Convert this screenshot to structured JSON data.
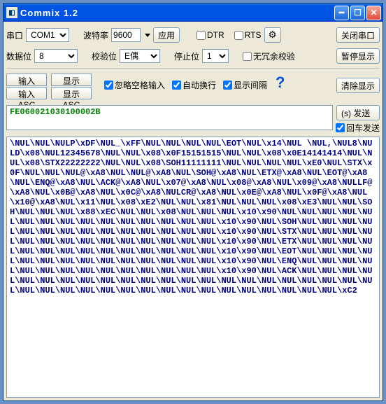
{
  "window": {
    "title": "Commix 1.2"
  },
  "row1": {
    "port_label": "串口",
    "port_value": "COM1",
    "baud_label": "波特率",
    "baud_value": "9600",
    "apply_btn": "应用",
    "dtr_label": "DTR",
    "rts_label": "RTS",
    "close_port_btn": "关闭串口"
  },
  "row2": {
    "databits_label": "数据位",
    "databits_value": "8",
    "parity_label": "校验位",
    "parity_value": "E偶",
    "stopbits_label": "停止位",
    "stopbits_value": "1",
    "noredundant_label": "无冗余校验",
    "pause_btn": "暂停显示"
  },
  "row3": {
    "in_hex": "输入HEX",
    "show_hex": "显示HEX",
    "in_asc": "输入ASC",
    "show_asc": "显示ASC",
    "ignore_space": "忽略空格输入",
    "auto_wrap": "自动换行",
    "show_gap": "显示间隔",
    "clear_btn": "清除显示"
  },
  "send": {
    "text": "FE060021030100002B",
    "send_btn": "(s) 发送",
    "enter_send": "回车发送"
  },
  "output_lines": [
    "\\NUL\\NUL\\NULP\\xDF\\NUL_\\xFF\\NUL\\NUL\\NUL\\NUL\\EOT\\NUL\\x14\\NUL \\NUL,\\NUL8\\NULD\\x08\\NUL12345678\\NUL\\NUL\\x08\\x0F15151515\\NUL\\NUL\\x08\\x0E14141414\\NUL\\NUL\\x08\\STX22222222\\NUL\\NUL\\x08\\SOH11111111\\NUL\\NUL\\NUL\\NUL\\xE0\\NUL\\STX\\x0F\\NUL\\NUL\\NUL@\\xA8\\NUL\\NUL@\\xA8\\NUL\\SOH@\\xA8\\NUL\\ETX@\\xA8\\NUL\\EOT@\\xA8\\NUL\\ENQ@\\xA8\\NUL\\ACK@\\xA8\\NUL\\x07@\\xA8\\NUL\\x08@\\xA8\\NUL\\x09@\\xA8\\NULLF@\\xA8\\NUL\\x0B@\\xA8\\NUL\\x0C@\\xA8\\NULCR@\\xA8\\NUL\\x0E@\\xA8\\NUL\\x0F@\\xA8\\NUL\\x10@\\xA8\\NUL\\x11\\NUL\\x08\\xE2\\NUL\\NUL\\x81\\NUL\\NUL\\NUL\\x08\\xE3\\NUL\\NUL\\SOH\\NUL\\NUL\\NUL\\x88\\xEC\\NUL\\NUL\\x08\\NUL\\NUL\\NUL\\x10\\x90\\NUL\\NUL\\NUL\\NUL\\NUL\\NUL\\NUL\\NUL\\NUL\\NUL\\NUL\\NUL\\NUL\\NUL\\NUL\\x10\\x90\\NUL\\SOH\\NUL\\NUL\\NUL\\NUL\\NUL\\NUL\\NUL\\NUL\\NUL\\NUL\\NUL\\NUL\\NUL\\NUL\\x10\\x90\\NUL\\STX\\NUL\\NUL\\NUL\\NUL\\NUL\\NUL\\NUL\\NUL\\NUL\\NUL\\NUL\\NUL\\NUL\\NUL\\x10\\x90\\NUL\\ETX\\NUL\\NUL\\NUL\\NUL\\NUL\\NUL\\NUL\\NUL\\NUL\\NUL\\NUL\\NUL\\NUL\\NUL\\x10\\x90\\NUL\\EOT\\NUL\\NUL\\NUL\\NUL\\NUL\\NUL\\NUL\\NUL\\NUL\\NUL\\NUL\\NUL\\NUL\\NUL\\x10\\x90\\NUL\\ENQ\\NUL\\NUL\\NUL\\NUL\\NUL\\NUL\\NUL\\NUL\\NUL\\NUL\\NUL\\NUL\\NUL\\NUL\\x10\\x90\\NUL\\ACK\\NUL\\NUL\\NUL\\NUL\\NUL\\NUL\\NUL\\NUL\\NUL\\NUL\\NUL\\NUL\\NUL\\NUL\\NUL\\NUL\\NUL\\NUL\\NUL\\NUL\\NUL\\NUL\\NUL\\NUL\\NUL\\NUL\\NUL\\NUL\\NUL\\NUL\\NUL\\NUL\\NUL\\NUL\\NUL\\NUL\\NUL\\NUL\\xC2"
  ]
}
